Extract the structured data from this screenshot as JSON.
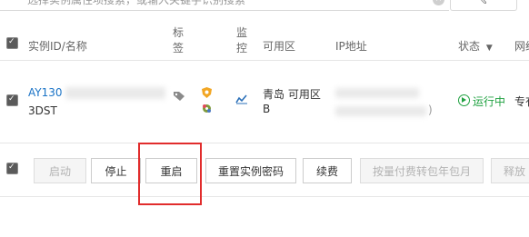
{
  "search": {
    "placeholder": "选择实例属性项搜索，或输入关键字识别搜索"
  },
  "table": {
    "headers": {
      "id_name": "实例ID/名称",
      "tags_line1": "标",
      "tags_line2": "签",
      "monitor_line1": "监",
      "monitor_line2": "控",
      "zone": "可用区",
      "ip": "IP地址",
      "status": "状态",
      "network": "网络"
    },
    "row": {
      "id_prefix": "AY130",
      "name_suffix": "3DST",
      "zone_line1": "青岛 可用区",
      "zone_line2": "B",
      "ip_tail": ")",
      "status": "运行中",
      "network_partial": "专有"
    }
  },
  "actions": {
    "start": "启动",
    "stop": "停止",
    "restart": "重启",
    "reset_password": "重置实例密码",
    "renew": "续费",
    "convert_billing": "按量付费转包年包月",
    "release": "释放"
  },
  "colors": {
    "link": "#1a73c6",
    "running": "#1fa140",
    "highlight": "#e12c2c"
  }
}
